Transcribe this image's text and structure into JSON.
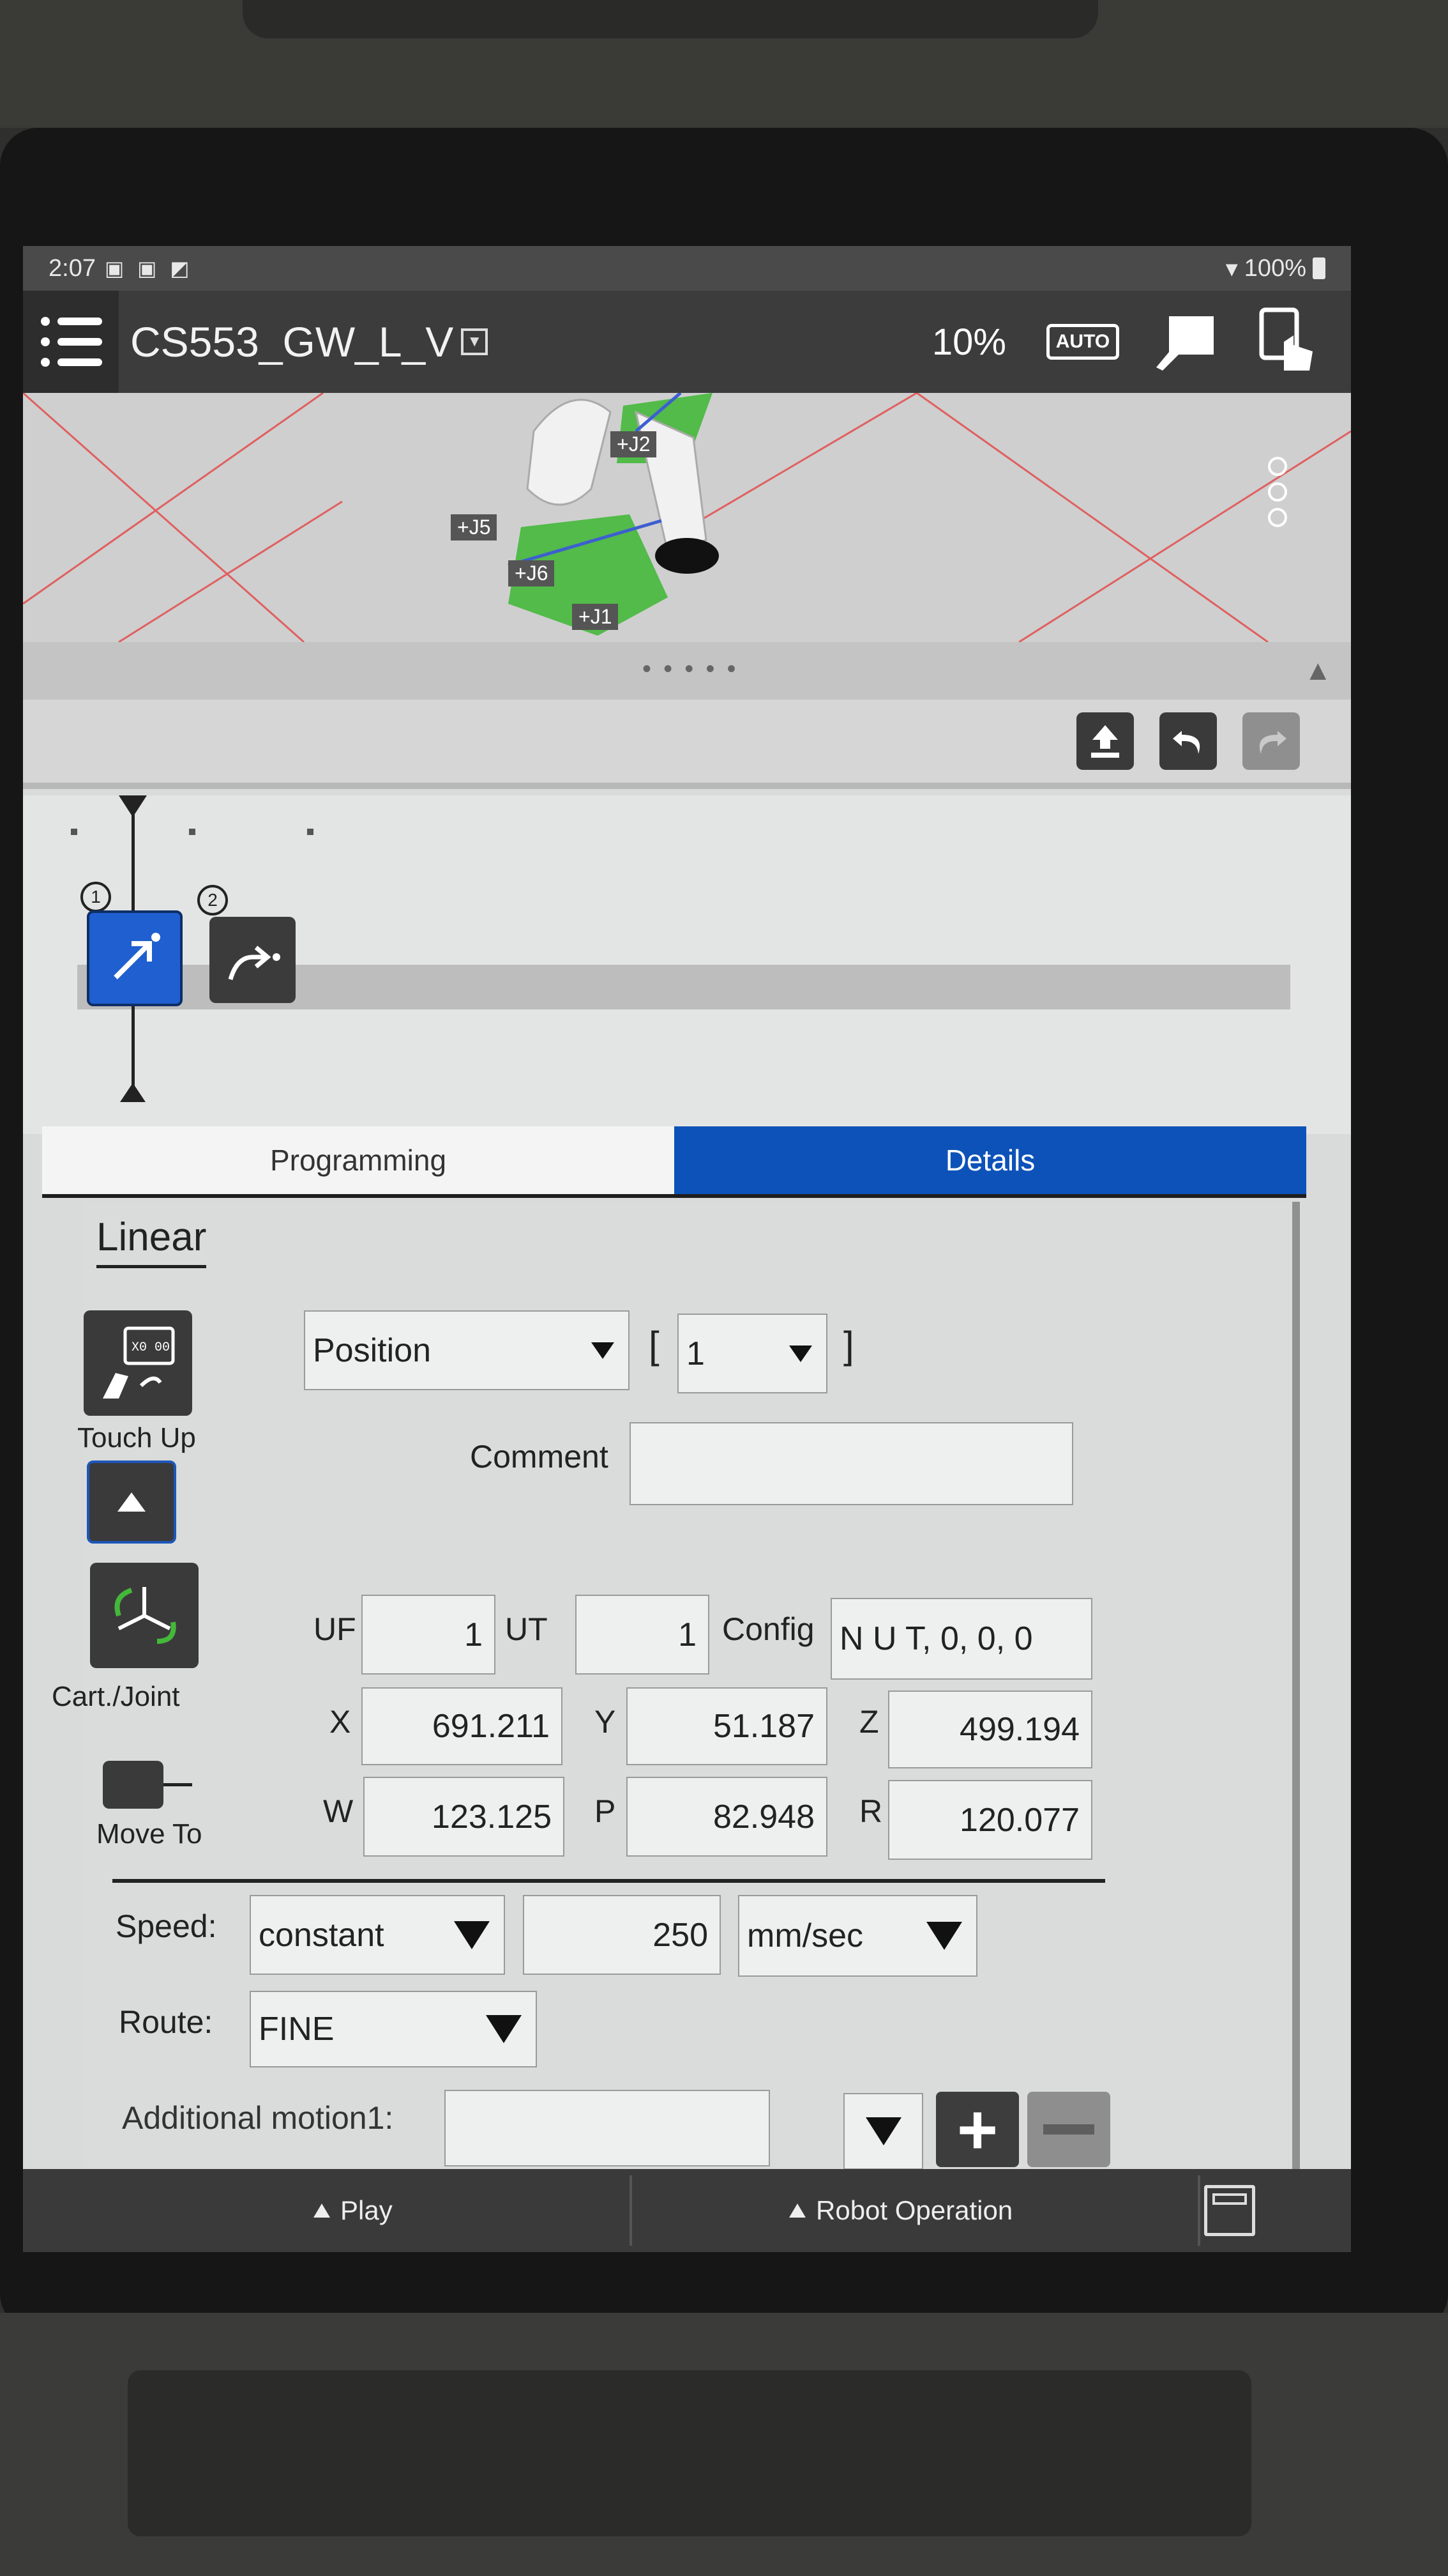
{
  "status_bar": {
    "time": "2:07",
    "battery": "100%"
  },
  "title_bar": {
    "program_name": "CS553_GW_L_V",
    "override": "10%",
    "auto_label": "AUTO"
  },
  "view3d": {
    "joint_labels": [
      "+J2",
      "+J5",
      "+J6",
      "+J1"
    ]
  },
  "timeline": {
    "nodes": [
      {
        "number": "1"
      },
      {
        "number": "2"
      }
    ]
  },
  "tabs": [
    "Programming",
    "Details"
  ],
  "details": {
    "title": "Linear",
    "position_type": "Position",
    "position_index": "1",
    "touch_up_label": "Touch Up",
    "cart_joint_label": "Cart./Joint",
    "move_to_label": "Move To",
    "comment_label": "Comment",
    "comment_value": "",
    "uf_label": "UF",
    "uf_value": "1",
    "ut_label": "UT",
    "ut_value": "1",
    "config_label": "Config",
    "config_value": "N U T, 0, 0, 0",
    "coords": {
      "x_label": "X",
      "x": "691.211",
      "y_label": "Y",
      "y": "51.187",
      "z_label": "Z",
      "z": "499.194",
      "w_label": "W",
      "w": "123.125",
      "p_label": "P",
      "p": "82.948",
      "r_label": "R",
      "r": "120.077"
    },
    "speed_label": "Speed:",
    "speed_type": "constant",
    "speed_value": "250",
    "speed_unit": "mm/sec",
    "route_label": "Route:",
    "route_value": "FINE",
    "additional_label": "Additional motion1:",
    "additional_value": ""
  },
  "bottom_bar": {
    "play": "Play",
    "robot_operation": "Robot Operation"
  }
}
